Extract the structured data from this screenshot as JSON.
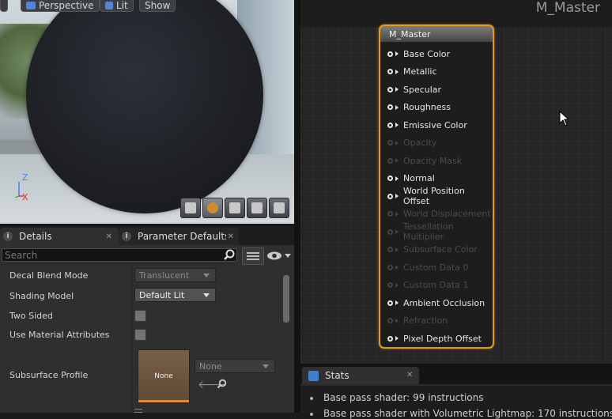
{
  "viewport": {
    "buttons": {
      "perspective": "Perspective",
      "lit": "Lit",
      "show": "Show"
    },
    "axis": {
      "z": "Z",
      "x": "X"
    }
  },
  "details_panel": {
    "tabs": [
      {
        "label": "Details"
      },
      {
        "label": "Parameter Defaults"
      }
    ],
    "search": {
      "placeholder": "Search"
    },
    "properties": {
      "decal_blend_mode": {
        "label": "Decal Blend Mode",
        "value": "Translucent"
      },
      "shading_model": {
        "label": "Shading Model",
        "value": "Default Lit"
      },
      "two_sided": {
        "label": "Two Sided"
      },
      "use_material_attributes": {
        "label": "Use Material Attributes"
      },
      "subsurface_profile": {
        "label": "Subsurface Profile",
        "thumb": "None",
        "value": "None"
      }
    }
  },
  "graph": {
    "title": "M_Master",
    "node": {
      "title": "M_Master",
      "pins": [
        {
          "label": "Base Color",
          "enabled": true
        },
        {
          "label": "Metallic",
          "enabled": true
        },
        {
          "label": "Specular",
          "enabled": true
        },
        {
          "label": "Roughness",
          "enabled": true
        },
        {
          "label": "Emissive Color",
          "enabled": true
        },
        {
          "label": "Opacity",
          "enabled": false
        },
        {
          "label": "Opacity Mask",
          "enabled": false
        },
        {
          "label": "Normal",
          "enabled": true
        },
        {
          "label": "World Position Offset",
          "enabled": true
        },
        {
          "label": "World Displacement",
          "enabled": false
        },
        {
          "label": "Tessellation Multiplier",
          "enabled": false
        },
        {
          "label": "Subsurface Color",
          "enabled": false
        },
        {
          "label": "Custom Data 0",
          "enabled": false
        },
        {
          "label": "Custom Data 1",
          "enabled": false
        },
        {
          "label": "Ambient Occlusion",
          "enabled": true
        },
        {
          "label": "Refraction",
          "enabled": false
        },
        {
          "label": "Pixel Depth Offset",
          "enabled": true
        }
      ]
    }
  },
  "stats": {
    "tab_label": "Stats",
    "lines": [
      "Base pass shader: 99 instructions",
      "Base pass shader with Volumetric Lightmap: 170 instructions"
    ]
  },
  "colors": {
    "node_border": "#e39a1d",
    "accent_blue": "#3f7fd0"
  }
}
